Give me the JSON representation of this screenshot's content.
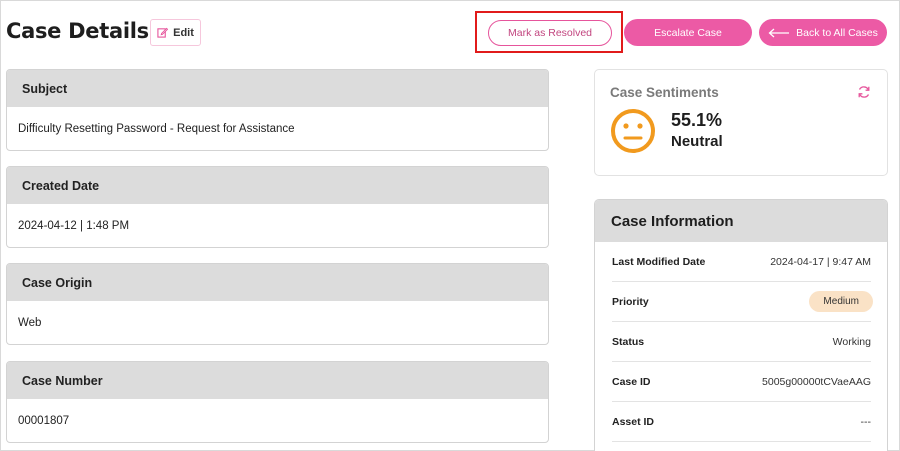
{
  "header": {
    "title": "Case Details",
    "edit_label": "Edit",
    "resolve_label": "Mark as Resolved",
    "escalate_label": "Escalate Case",
    "back_label": "Back to All Cases"
  },
  "cards": [
    {
      "label": "Subject",
      "value": "Difficulty Resetting Password - Request for Assistance"
    },
    {
      "label": "Created Date",
      "value": "2024-04-12 | 1:48 PM"
    },
    {
      "label": "Case Origin",
      "value": "Web"
    },
    {
      "label": "Case Number",
      "value": "00001807"
    }
  ],
  "sentiment": {
    "title": "Case Sentiments",
    "percent": "55.1%",
    "label": "Neutral",
    "icon": "neutral-face-icon",
    "color": "#f19a1e"
  },
  "case_info": {
    "title": "Case Information",
    "rows": [
      {
        "label": "Last Modified Date",
        "value": "2024-04-17 | 9:47 AM"
      },
      {
        "label": "Priority",
        "value": "Medium"
      },
      {
        "label": "Status",
        "value": "Working"
      },
      {
        "label": "Case ID",
        "value": "5005g00000tCVaeAAG"
      },
      {
        "label": "Asset ID",
        "value": "---"
      }
    ]
  },
  "colors": {
    "accent": "#ec5aa5",
    "highlight_box": "#e11b1b",
    "priority_badge": "#fae2c6"
  }
}
